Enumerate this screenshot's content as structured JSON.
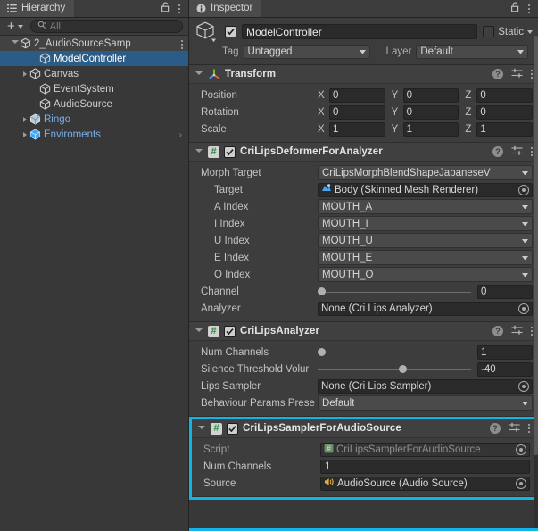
{
  "hierarchy": {
    "tab_label": "Hierarchy",
    "tab_icon": "hierarchy-icon",
    "lock_icon": "lock-icon",
    "menu_icon": "kebab-menu-icon",
    "toolbar": {
      "add_label": "+",
      "add_dropdown_icon": "chevron-down-icon",
      "search_icon": "search-icon",
      "search_placeholder": "All",
      "search_value": ""
    },
    "items": [
      {
        "label": "2_AudioSourceSamp",
        "icon": "scene-icon",
        "depth": 0,
        "expanded": true,
        "selected": false,
        "is_scene": true,
        "has_menu": true,
        "prefab": false
      },
      {
        "label": "ModelController",
        "icon": "gameobject-icon",
        "depth": 2,
        "expanded": null,
        "selected": true,
        "is_scene": false,
        "has_menu": false,
        "prefab": false
      },
      {
        "label": "Canvas",
        "icon": "gameobject-icon",
        "depth": 1,
        "expanded": false,
        "selected": false,
        "is_scene": false,
        "has_menu": false,
        "prefab": false
      },
      {
        "label": "EventSystem",
        "icon": "gameobject-icon",
        "depth": 2,
        "expanded": null,
        "selected": false,
        "is_scene": false,
        "has_menu": false,
        "prefab": false
      },
      {
        "label": "AudioSource",
        "icon": "gameobject-icon",
        "depth": 2,
        "expanded": null,
        "selected": false,
        "is_scene": false,
        "has_menu": false,
        "prefab": false
      },
      {
        "label": "Ringo",
        "icon": "prefab-variant-icon",
        "depth": 1,
        "expanded": false,
        "selected": false,
        "is_scene": false,
        "has_menu": false,
        "prefab": true
      },
      {
        "label": "Enviroments",
        "icon": "prefab-icon",
        "depth": 1,
        "expanded": false,
        "selected": false,
        "is_scene": false,
        "has_menu": false,
        "prefab": true,
        "overflow_arrow": ">"
      }
    ]
  },
  "inspector": {
    "tab_label": "Inspector",
    "tab_icon": "info-icon",
    "lock_icon": "lock-icon",
    "menu_icon": "kebab-menu-icon",
    "object_header": {
      "prefab_icon": "gameobject-cube-icon",
      "enabled": true,
      "name": "ModelController",
      "static_label": "Static",
      "static_checked": false,
      "tag_label": "Tag",
      "tag_value": "Untagged",
      "layer_label": "Layer",
      "layer_value": "Default"
    },
    "components": [
      {
        "name": "Transform",
        "icon": "transform-gizmo-icon",
        "expanded": true,
        "has_checkbox": false,
        "highlighted": false,
        "rows": [
          {
            "kind": "vector3",
            "label": "Position",
            "axes": [
              "X",
              "Y",
              "Z"
            ],
            "values": [
              "0",
              "0",
              "0"
            ]
          },
          {
            "kind": "vector3",
            "label": "Rotation",
            "axes": [
              "X",
              "Y",
              "Z"
            ],
            "values": [
              "0",
              "0",
              "0"
            ]
          },
          {
            "kind": "vector3",
            "label": "Scale",
            "axes": [
              "X",
              "Y",
              "Z"
            ],
            "values": [
              "1",
              "1",
              "1"
            ]
          }
        ]
      },
      {
        "name": "CriLipsDeformerForAnalyzer",
        "icon": "csharp-script-icon",
        "expanded": true,
        "has_checkbox": true,
        "checked": true,
        "highlighted": false,
        "rows": [
          {
            "kind": "dropdown",
            "label": "Morph Target",
            "value": "CriLipsMorphBlendShapeJapaneseV",
            "indent": false
          },
          {
            "kind": "object",
            "label": "Target",
            "value": "Body  (Skinned Mesh Renderer)",
            "value_icon": "skinned-mesh-renderer-icon",
            "indent": true
          },
          {
            "kind": "dropdown",
            "label": "A Index",
            "value": "MOUTH_A",
            "indent": true
          },
          {
            "kind": "dropdown",
            "label": "I Index",
            "value": "MOUTH_I",
            "indent": true
          },
          {
            "kind": "dropdown",
            "label": "U Index",
            "value": "MOUTH_U",
            "indent": true
          },
          {
            "kind": "dropdown",
            "label": "E Index",
            "value": "MOUTH_E",
            "indent": true
          },
          {
            "kind": "dropdown",
            "label": "O Index",
            "value": "MOUTH_O",
            "indent": true
          },
          {
            "kind": "slider",
            "label": "Channel",
            "value": "0",
            "percent": 0
          },
          {
            "kind": "object",
            "label": "Analyzer",
            "value": "None (Cri Lips Analyzer)",
            "value_icon": null,
            "indent": false
          }
        ]
      },
      {
        "name": "CriLipsAnalyzer",
        "icon": "csharp-script-icon",
        "expanded": true,
        "has_checkbox": true,
        "checked": true,
        "highlighted": false,
        "rows": [
          {
            "kind": "slider",
            "label": "Num Channels",
            "value": "1",
            "percent": 0
          },
          {
            "kind": "slider",
            "label": "Silence Threshold Volur",
            "value": "-40",
            "percent": 56
          },
          {
            "kind": "object",
            "label": "Lips Sampler",
            "value": "None (Cri Lips Sampler)",
            "value_icon": null,
            "indent": false
          },
          {
            "kind": "dropdown",
            "label": "Behaviour Params Prese",
            "value": "Default",
            "indent": false
          }
        ]
      },
      {
        "name": "CriLipsSamplerForAudioSource",
        "icon": "csharp-script-icon",
        "expanded": true,
        "has_checkbox": true,
        "checked": true,
        "highlighted": true,
        "rows": [
          {
            "kind": "object",
            "label": "Script",
            "value": "CriLipsSamplerForAudioSource",
            "value_icon": "csharp-file-icon",
            "disabled": true,
            "indent": false
          },
          {
            "kind": "text",
            "label": "Num Channels",
            "value": "1"
          },
          {
            "kind": "object",
            "label": "Source",
            "value": "AudioSource (Audio Source)",
            "value_icon": "audio-source-icon",
            "indent": false
          }
        ]
      }
    ],
    "header_icons": {
      "help": "help-icon",
      "preset": "preset-icon",
      "menu": "kebab-menu-icon"
    }
  },
  "colors": {
    "selection_blue": "#2b5c87",
    "highlight_cyan": "#10b5e8",
    "panel_bg": "#383838",
    "component_bg": "#3d3d3d",
    "prefab_text": "#7aadea"
  }
}
